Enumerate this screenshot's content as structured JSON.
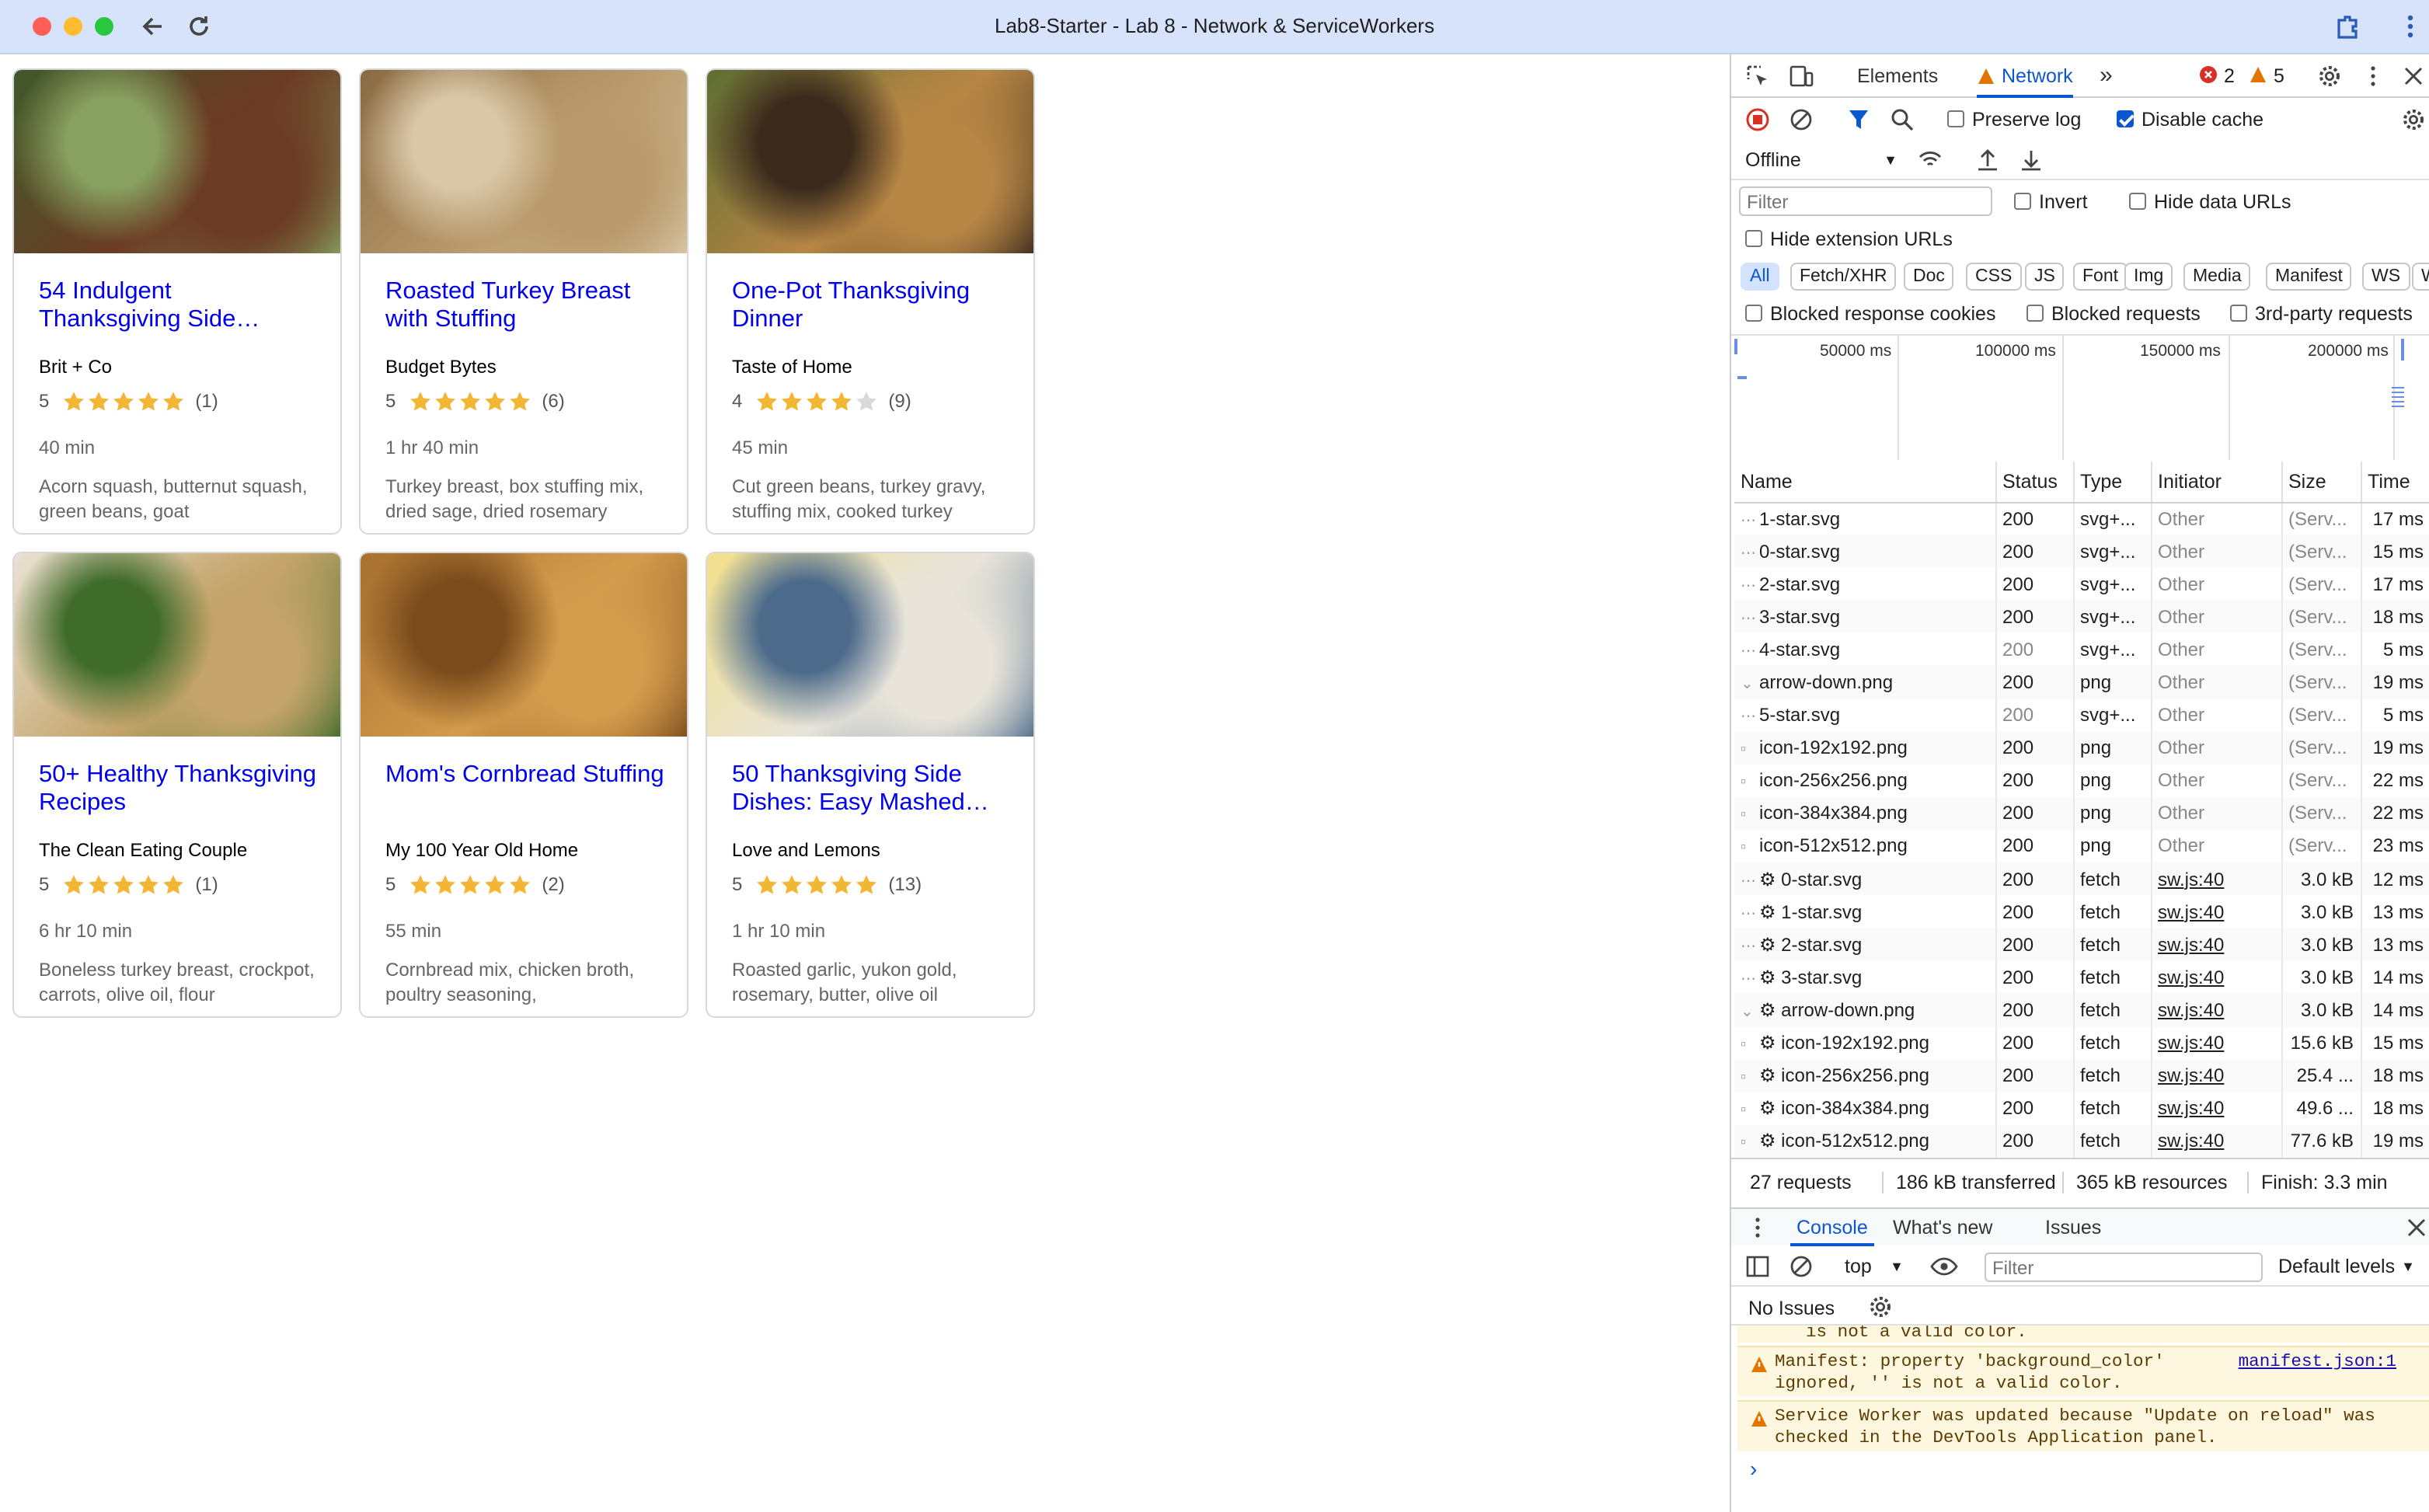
{
  "window": {
    "title": "Lab8-Starter - Lab 8 - Network & ServiceWorkers"
  },
  "recipes": [
    {
      "title": "54 Indulgent Thanksgiving Side…",
      "org": "Brit + Co",
      "rating": "5",
      "stars": 5,
      "count": "(1)",
      "time": "40 min",
      "ingredients": "Acorn squash, butternut squash, green beans, goat",
      "img_colors": [
        "#3f5a2a",
        "#6b3b24",
        "#88a060"
      ]
    },
    {
      "title": "Roasted Turkey Breast with Stuffing",
      "org": "Budget Bytes",
      "rating": "5",
      "stars": 5,
      "count": "(6)",
      "time": "1 hr 40 min",
      "ingredients": "Turkey breast, box stuffing mix, dried sage, dried rosemary",
      "img_colors": [
        "#8a6a42",
        "#b99a6c",
        "#d9c8a8"
      ]
    },
    {
      "title": "One-Pot Thanksgiving Dinner",
      "org": "Taste of Home",
      "rating": "4",
      "stars": 4,
      "count": "(9)",
      "time": "45 min",
      "ingredients": "Cut green beans, turkey gravy, stuffing mix, cooked turkey",
      "img_colors": [
        "#5d6e32",
        "#b78645",
        "#3a2a1c"
      ]
    },
    {
      "title": "50+ Healthy Thanksgiving Recipes",
      "org": "The Clean Eating Couple",
      "rating": "5",
      "stars": 5,
      "count": "(1)",
      "time": "6 hr 10 min",
      "ingredients": "Boneless turkey breast, crockpot, carrots, olive oil, flour",
      "img_colors": [
        "#e9e2d4",
        "#c4a46a",
        "#3f6b2b"
      ]
    },
    {
      "title": "Mom's Cornbread Stuffing",
      "org": "My 100 Year Old Home",
      "rating": "5",
      "stars": 5,
      "count": "(2)",
      "time": "55 min",
      "ingredients": "Cornbread mix, chicken broth, poultry seasoning,",
      "img_colors": [
        "#a8702e",
        "#d39b4c",
        "#7a4b1c"
      ]
    },
    {
      "title": "50 Thanksgiving Side Dishes: Easy Mashed…",
      "org": "Love and Lemons",
      "rating": "5",
      "stars": 5,
      "count": "(13)",
      "time": "1 hr 10 min",
      "ingredients": "Roasted garlic, yukon gold, rosemary, butter, olive oil",
      "img_colors": [
        "#f2e08a",
        "#e8e4da",
        "#4c6a8a"
      ]
    }
  ],
  "devtools": {
    "tabs": {
      "elements": "Elements",
      "network": "Network"
    },
    "errors": "2",
    "warnings": "5",
    "preserve_log": "Preserve log",
    "disable_cache": "Disable cache",
    "throttle": "Offline",
    "filter_placeholder": "Filter",
    "invert": "Invert",
    "hide_data_urls": "Hide data URLs",
    "hide_ext_urls": "Hide extension URLs",
    "type_filters": [
      "All",
      "Fetch/XHR",
      "Doc",
      "CSS",
      "JS",
      "Font",
      "Img",
      "Media",
      "Manifest",
      "WS",
      "W"
    ],
    "blocked_cookies": "Blocked response cookies",
    "blocked_requests": "Blocked requests",
    "third_party": "3rd-party requests",
    "timeline_ticks": [
      "50000 ms",
      "100000 ms",
      "150000 ms",
      "200000 ms"
    ],
    "columns": [
      "Name",
      "Status",
      "Type",
      "Initiator",
      "Size",
      "Time"
    ],
    "rows": [
      {
        "name": "1-star.svg",
        "status": "200",
        "type": "svg+...",
        "initiator": "Other",
        "size": "(Serv...",
        "time": "17 ms",
        "icon": "dots",
        "faded": false,
        "link": false
      },
      {
        "name": "0-star.svg",
        "status": "200",
        "type": "svg+...",
        "initiator": "Other",
        "size": "(Serv...",
        "time": "15 ms",
        "icon": "dots",
        "faded": false,
        "link": false
      },
      {
        "name": "2-star.svg",
        "status": "200",
        "type": "svg+...",
        "initiator": "Other",
        "size": "(Serv...",
        "time": "17 ms",
        "icon": "dots",
        "faded": false,
        "link": false
      },
      {
        "name": "3-star.svg",
        "status": "200",
        "type": "svg+...",
        "initiator": "Other",
        "size": "(Serv...",
        "time": "18 ms",
        "icon": "dots",
        "faded": false,
        "link": false
      },
      {
        "name": "4-star.svg",
        "status": "200",
        "type": "svg+...",
        "initiator": "Other",
        "size": "(Serv...",
        "time": "5 ms",
        "icon": "dots",
        "faded": true,
        "link": false
      },
      {
        "name": "arrow-down.png",
        "status": "200",
        "type": "png",
        "initiator": "Other",
        "size": "(Serv...",
        "time": "19 ms",
        "icon": "chevron",
        "faded": false,
        "link": false
      },
      {
        "name": "5-star.svg",
        "status": "200",
        "type": "svg+...",
        "initiator": "Other",
        "size": "(Serv...",
        "time": "5 ms",
        "icon": "dots",
        "faded": true,
        "link": false
      },
      {
        "name": "icon-192x192.png",
        "status": "200",
        "type": "png",
        "initiator": "Other",
        "size": "(Serv...",
        "time": "19 ms",
        "icon": "img",
        "faded": false,
        "link": false
      },
      {
        "name": "icon-256x256.png",
        "status": "200",
        "type": "png",
        "initiator": "Other",
        "size": "(Serv...",
        "time": "22 ms",
        "icon": "img",
        "faded": false,
        "link": false
      },
      {
        "name": "icon-384x384.png",
        "status": "200",
        "type": "png",
        "initiator": "Other",
        "size": "(Serv...",
        "time": "22 ms",
        "icon": "img",
        "faded": false,
        "link": false
      },
      {
        "name": "icon-512x512.png",
        "status": "200",
        "type": "png",
        "initiator": "Other",
        "size": "(Serv...",
        "time": "23 ms",
        "icon": "img",
        "faded": false,
        "link": false
      },
      {
        "name": "⚙ 0-star.svg",
        "status": "200",
        "type": "fetch",
        "initiator": "sw.js:40",
        "size": "3.0 kB",
        "time": "12 ms",
        "icon": "dots",
        "faded": false,
        "link": true
      },
      {
        "name": "⚙ 1-star.svg",
        "status": "200",
        "type": "fetch",
        "initiator": "sw.js:40",
        "size": "3.0 kB",
        "time": "13 ms",
        "icon": "dots",
        "faded": false,
        "link": true
      },
      {
        "name": "⚙ 2-star.svg",
        "status": "200",
        "type": "fetch",
        "initiator": "sw.js:40",
        "size": "3.0 kB",
        "time": "13 ms",
        "icon": "dots",
        "faded": false,
        "link": true
      },
      {
        "name": "⚙ 3-star.svg",
        "status": "200",
        "type": "fetch",
        "initiator": "sw.js:40",
        "size": "3.0 kB",
        "time": "14 ms",
        "icon": "dots",
        "faded": false,
        "link": true
      },
      {
        "name": "⚙ arrow-down.png",
        "status": "200",
        "type": "fetch",
        "initiator": "sw.js:40",
        "size": "3.0 kB",
        "time": "14 ms",
        "icon": "chevron",
        "faded": false,
        "link": true
      },
      {
        "name": "⚙ icon-192x192.png",
        "status": "200",
        "type": "fetch",
        "initiator": "sw.js:40",
        "size": "15.6 kB",
        "time": "15 ms",
        "icon": "img",
        "faded": false,
        "link": true
      },
      {
        "name": "⚙ icon-256x256.png",
        "status": "200",
        "type": "fetch",
        "initiator": "sw.js:40",
        "size": "25.4 ...",
        "time": "18 ms",
        "icon": "img",
        "faded": false,
        "link": true
      },
      {
        "name": "⚙ icon-384x384.png",
        "status": "200",
        "type": "fetch",
        "initiator": "sw.js:40",
        "size": "49.6 ...",
        "time": "18 ms",
        "icon": "img",
        "faded": false,
        "link": true
      },
      {
        "name": "⚙ icon-512x512.png",
        "status": "200",
        "type": "fetch",
        "initiator": "sw.js:40",
        "size": "77.6 kB",
        "time": "19 ms",
        "icon": "img",
        "faded": false,
        "link": true
      }
    ],
    "summary": {
      "requests": "27 requests",
      "transferred": "186 kB transferred",
      "resources": "365 kB resources",
      "finish": "Finish: 3.3 min"
    },
    "drawer_tabs": {
      "console": "Console",
      "whats_new": "What's new",
      "issues": "Issues"
    },
    "console_context": "top",
    "console_filter_placeholder": "Filter",
    "levels": "Default levels",
    "no_issues": "No Issues",
    "messages": [
      {
        "text": "is not a valid color.",
        "source": ""
      },
      {
        "text": "Manifest: property 'background_color' ignored, '' is not a valid color.",
        "source": "manifest.json:1"
      },
      {
        "text": "Service Worker was updated because \"Update on reload\" was checked in the DevTools Application panel.",
        "source": ""
      }
    ],
    "prompt": "›"
  },
  "colors": {
    "accent": "#0b57d0",
    "link": "#0000ee",
    "star": "#f2b632",
    "warning_bg": "#fef7e0"
  }
}
